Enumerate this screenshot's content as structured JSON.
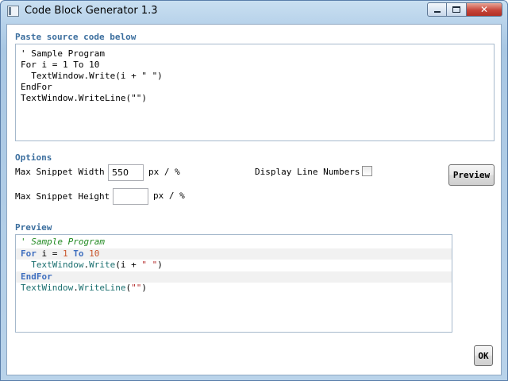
{
  "window": {
    "title": "Code Block Generator 1.3",
    "close_glyph": "✕"
  },
  "source": {
    "label": "Paste source code below",
    "text": "' Sample Program\nFor i = 1 To 10\n  TextWindow.Write(i + \" \")\nEndFor\nTextWindow.WriteLine(\"\")"
  },
  "options": {
    "label": "Options",
    "max_width_label": "Max Snippet Width",
    "max_width_value": "550",
    "max_width_unit": "px / %",
    "max_height_label": "Max Snippet Height",
    "max_height_value": "",
    "max_height_unit": "px / %",
    "line_numbers_label": "Display Line Numbers",
    "line_numbers_checked": false,
    "preview_button": "Preview"
  },
  "preview": {
    "label": "Preview",
    "lines": [
      [
        {
          "t": "' Sample Program",
          "k": "comment"
        }
      ],
      [
        {
          "t": "For",
          "k": "keyword"
        },
        {
          "t": " i = ",
          "k": "plain"
        },
        {
          "t": "1",
          "k": "number"
        },
        {
          "t": " ",
          "k": "plain"
        },
        {
          "t": "To",
          "k": "keyword"
        },
        {
          "t": " ",
          "k": "plain"
        },
        {
          "t": "10",
          "k": "number"
        }
      ],
      [
        {
          "t": "  ",
          "k": "plain"
        },
        {
          "t": "TextWindow",
          "k": "ident"
        },
        {
          "t": ".",
          "k": "plain"
        },
        {
          "t": "Write",
          "k": "ident"
        },
        {
          "t": "(i + ",
          "k": "plain"
        },
        {
          "t": "\" \"",
          "k": "string"
        },
        {
          "t": ")",
          "k": "plain"
        }
      ],
      [
        {
          "t": "EndFor",
          "k": "keyword"
        }
      ],
      [
        {
          "t": "TextWindow",
          "k": "ident"
        },
        {
          "t": ".",
          "k": "plain"
        },
        {
          "t": "WriteLine",
          "k": "ident"
        },
        {
          "t": "(",
          "k": "plain"
        },
        {
          "t": "\"\"",
          "k": "string"
        },
        {
          "t": ")",
          "k": "plain"
        }
      ]
    ],
    "colors": {
      "comment": "#218a21",
      "keyword": "#3f6fbf",
      "number": "#c8542a",
      "string": "#b42a2a",
      "ident": "#1b6f6f"
    }
  },
  "footer": {
    "ok_button": "OK"
  }
}
